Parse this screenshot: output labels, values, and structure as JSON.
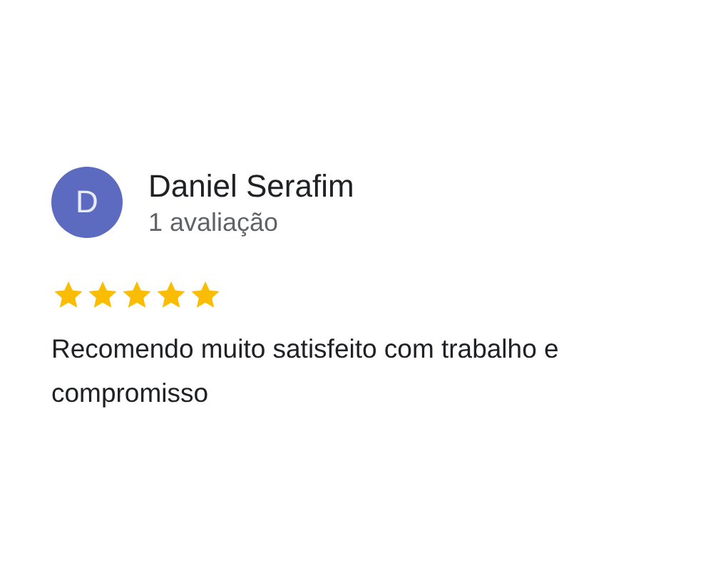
{
  "review": {
    "avatar_letter": "D",
    "author": "Daniel Serafim",
    "review_count": "1 avaliação",
    "stars": 5,
    "text": "Recomendo muito satisfeito com trabalho e compromisso"
  }
}
